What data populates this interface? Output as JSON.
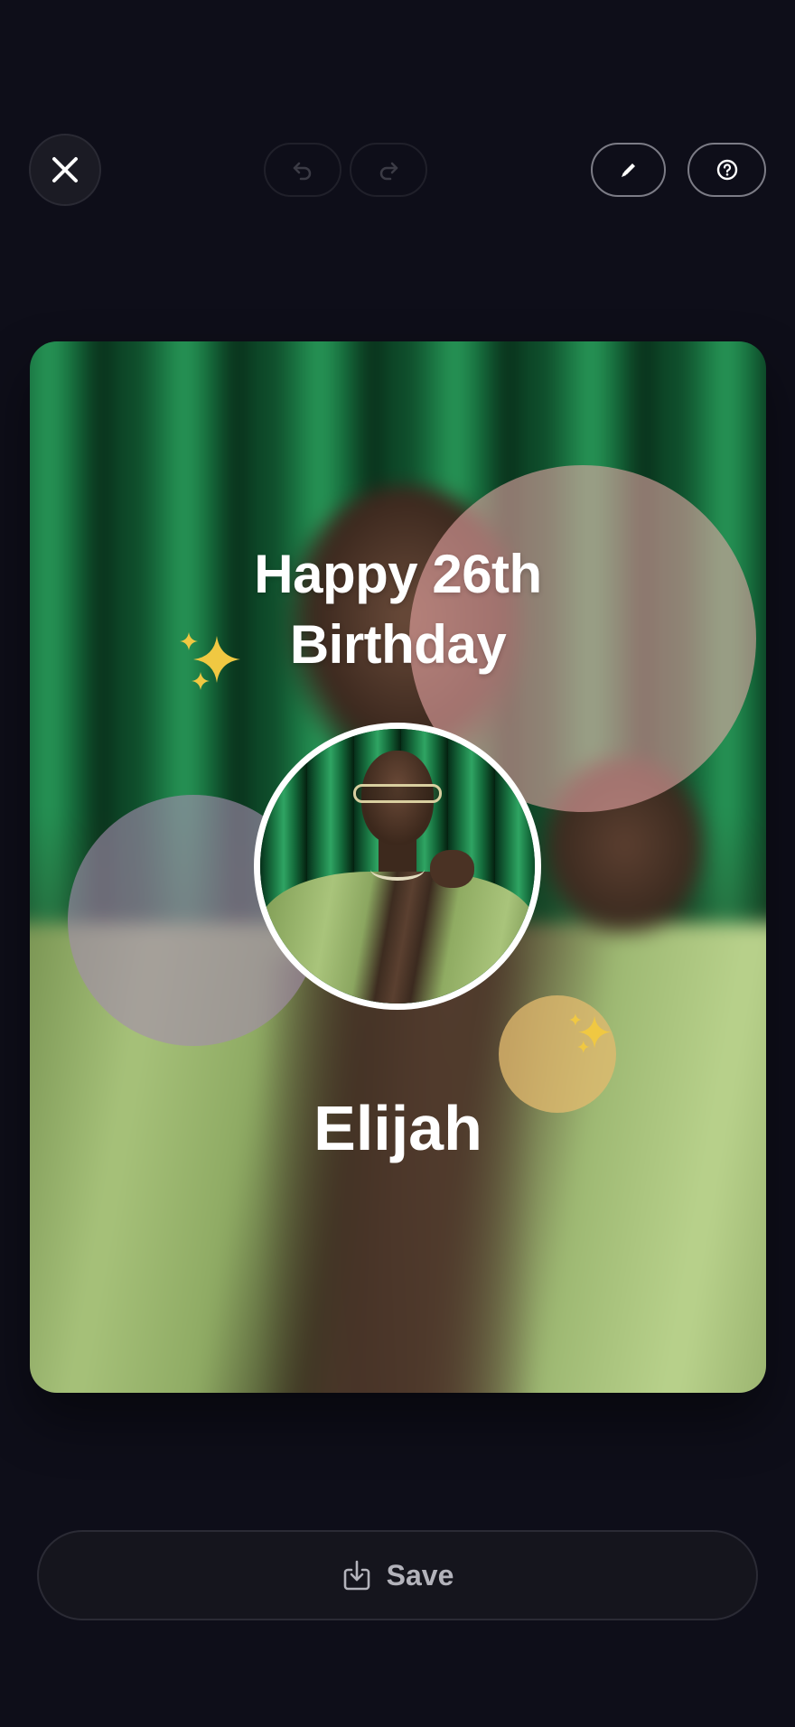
{
  "toolbar": {
    "close_icon": "close-icon",
    "undo_icon": "undo-icon",
    "redo_icon": "redo-icon",
    "edit_icon": "pencil-icon",
    "help_icon": "help-circle-icon"
  },
  "card": {
    "headline_line1": "Happy 26th",
    "headline_line2": "Birthday",
    "name": "Elijah",
    "decorations": [
      "sparkles-icon",
      "sparkles-icon"
    ],
    "colors": {
      "pink_bubble": "#eca8a8",
      "lilac_bubble": "#a58caf",
      "gold_bubble": "#e2ba6e",
      "sparkle": "#f0c842",
      "curtain": "#1b7a45",
      "jacket": "#a7c27a"
    }
  },
  "footer": {
    "save_label": "Save",
    "save_icon": "download-icon"
  },
  "colors": {
    "background": "#0e0e19",
    "button_surface": "#15151d"
  }
}
